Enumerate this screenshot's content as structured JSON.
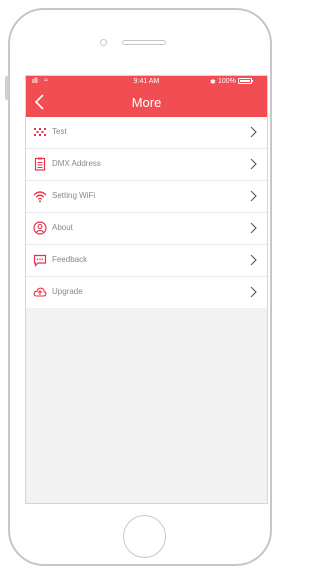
{
  "status_bar": {
    "signal": "ıll",
    "wifi": "≈",
    "time": "9:41 AM",
    "bluetooth": "✱",
    "battery": "100%"
  },
  "header": {
    "title": "More",
    "back_icon": "chevron-left-icon",
    "background": "#f24d52"
  },
  "menu": {
    "accent": "#e8334a",
    "items": [
      {
        "label": "Test",
        "icon": "test-icon"
      },
      {
        "label": "DMX Address",
        "icon": "clipboard-icon"
      },
      {
        "label": "Setting WiFi",
        "icon": "wifi-icon"
      },
      {
        "label": "About",
        "icon": "user-circle-icon"
      },
      {
        "label": "Feedback",
        "icon": "chat-icon"
      },
      {
        "label": "Upgrade",
        "icon": "cloud-upload-icon"
      }
    ]
  }
}
